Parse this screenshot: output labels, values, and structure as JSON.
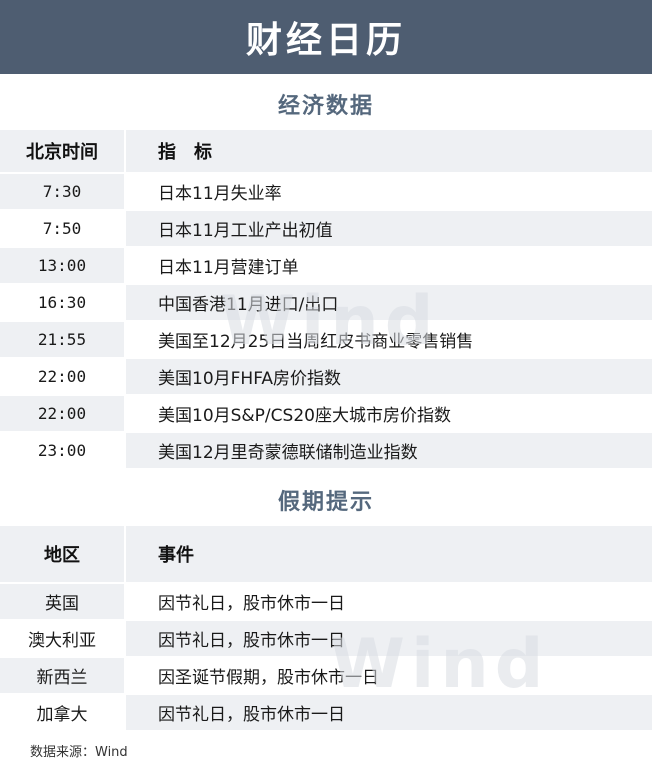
{
  "banner": {
    "title": "财经日历"
  },
  "economic": {
    "section_title": "经济数据",
    "headers": {
      "time": "北京时间",
      "indicator": "指　标"
    },
    "rows": [
      {
        "time": "7:30",
        "indicator": "日本11月失业率"
      },
      {
        "time": "7:50",
        "indicator": "日本11月工业产出初值"
      },
      {
        "time": "13:00",
        "indicator": "日本11月营建订单"
      },
      {
        "time": "16:30",
        "indicator": "中国香港11月进口/出口"
      },
      {
        "time": "21:55",
        "indicator": "美国至12月25日当周红皮书商业零售销售"
      },
      {
        "time": "22:00",
        "indicator": "美国10月FHFA房价指数"
      },
      {
        "time": "22:00",
        "indicator": "美国10月S&P/CS20座大城市房价指数"
      },
      {
        "time": "23:00",
        "indicator": "美国12月里奇蒙德联储制造业指数"
      }
    ]
  },
  "holiday": {
    "section_title": "假期提示",
    "headers": {
      "region": "地区",
      "event": "事件"
    },
    "rows": [
      {
        "region": "英国",
        "event": "因节礼日，股市休市一日"
      },
      {
        "region": "澳大利亚",
        "event": "因节礼日，股市休市一日"
      },
      {
        "region": "新西兰",
        "event": "因圣诞节假期，股市休市一日"
      },
      {
        "region": "加拿大",
        "event": "因节礼日，股市休市一日"
      }
    ]
  },
  "footer": {
    "source": "数据来源：Wind"
  },
  "watermark": {
    "text": "Wind"
  },
  "colors": {
    "banner": "#4e5d71",
    "section_text": "#55687d",
    "stripe": "#eef0f3"
  }
}
